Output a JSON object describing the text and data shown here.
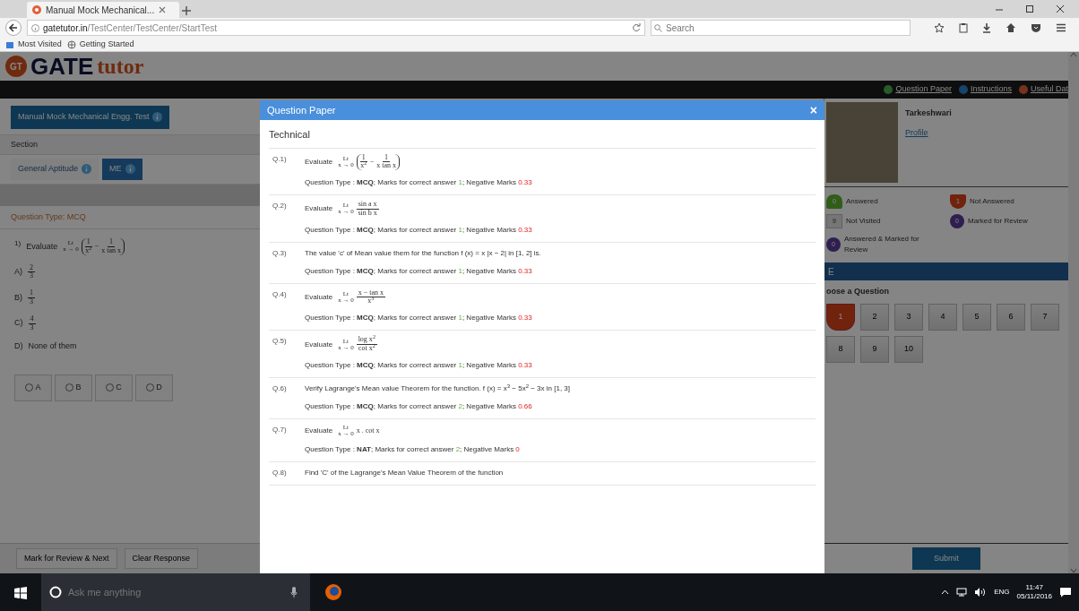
{
  "browser": {
    "tab_title": "Manual Mock Mechanical...",
    "url_host": "gatetutor.in",
    "url_path": "/TestCenter/TestCenter/StartTest",
    "search_placeholder": "Search",
    "bookmarks": [
      "Most Visited",
      "Getting Started"
    ]
  },
  "page": {
    "logo": {
      "mark": "GT",
      "word": "GATE",
      "tail": "tutor"
    },
    "test_name": "Manual Mock Mechanical Engg. Test",
    "section_label": "Section",
    "sections": [
      {
        "label": "General Aptitude",
        "selected": false
      },
      {
        "label": "ME",
        "selected": true
      }
    ],
    "question_type": "Question Type: MCQ",
    "question": {
      "number": "1)",
      "prompt": "Evaluate",
      "formula": [
        {
          "kind": "lim",
          "op": "Lt",
          "sub": "x → 0"
        },
        {
          "kind": "paren",
          "items": [
            {
              "kind": "frac",
              "num": "1",
              "den": "x$^{2}$"
            },
            {
              "kind": "text",
              "text": "−"
            },
            {
              "kind": "frac",
              "num": "1",
              "den": "x tan x"
            }
          ]
        }
      ]
    },
    "options": [
      {
        "label": "A)",
        "formula": [
          {
            "kind": "frac",
            "num": "2",
            "den": "3"
          }
        ]
      },
      {
        "label": "B)",
        "formula": [
          {
            "kind": "frac",
            "num": "1",
            "den": "3"
          }
        ]
      },
      {
        "label": "C)",
        "formula": [
          {
            "kind": "frac",
            "num": "4",
            "den": "3"
          }
        ]
      },
      {
        "label": "D)",
        "text": "None of them"
      }
    ],
    "answer_choices": [
      {
        "letter": "A",
        "selected": false
      },
      {
        "letter": "B",
        "selected": false
      },
      {
        "letter": "C",
        "selected": false
      },
      {
        "letter": "D",
        "selected": false
      }
    ],
    "buttons": [
      "Mark for Review & Next",
      "Clear Response"
    ],
    "top_links": [
      {
        "label": "Question Paper",
        "kind": "paper"
      },
      {
        "label": "Instructions",
        "kind": "info"
      },
      {
        "label": "Useful Dat",
        "kind": "data"
      }
    ],
    "candidate": {
      "name": "Tarkeshwari",
      "link": "Profile"
    },
    "legend": [
      {
        "kind": "answered",
        "count": "0",
        "label": "Answered"
      },
      {
        "kind": "unanswered",
        "count": "1",
        "label": "Not Answered"
      },
      {
        "kind": "unvisited",
        "count": "9",
        "label": "Not Visited"
      },
      {
        "kind": "marked",
        "count": "0",
        "label": "Marked for Review"
      },
      {
        "kind": "answeredmarked",
        "count": "0",
        "label": "Answered & Marked for Review"
      }
    ],
    "palette_title": "E",
    "choose_label": "oose a Question",
    "palette": [
      {
        "label": "1",
        "kind": "unanswered"
      },
      {
        "label": "2",
        "kind": "unvisited"
      },
      {
        "label": "3",
        "kind": "unvisited"
      },
      {
        "label": "4",
        "kind": "unvisited"
      },
      {
        "label": "5",
        "kind": "unvisited"
      },
      {
        "label": "6",
        "kind": "unvisited"
      },
      {
        "label": "7",
        "kind": "unvisited"
      },
      {
        "label": "8",
        "kind": "unvisited"
      },
      {
        "label": "9",
        "kind": "unvisited"
      },
      {
        "label": "10",
        "kind": "unvisited"
      }
    ],
    "submit": "Submit"
  },
  "modal": {
    "title": "Question Paper",
    "close": "×",
    "section": "Technical",
    "questions": [
      {
        "number": "Q.1)",
        "prompt": "Evaluate",
        "formula": [
          {
            "kind": "lim",
            "op": "Lt",
            "sub": "x → 0"
          },
          {
            "kind": "paren",
            "items": [
              {
                "kind": "frac",
                "num": "1",
                "den": "x$^{2}$"
              },
              {
                "kind": "text",
                "text": "−"
              },
              {
                "kind": "frac",
                "num": "1",
                "den": "x tan x"
              }
            ]
          }
        ],
        "type_label": "Question Type :",
        "type": "MCQ",
        "marks_label": "; Marks for correct answer",
        "marks": "1",
        "negative_label": "; Negative Marks",
        "negative": "0.33"
      },
      {
        "number": "Q.2)",
        "prompt": "Evaluate",
        "formula": [
          {
            "kind": "lim",
            "op": "Lt",
            "sub": "x → 0"
          },
          {
            "kind": "frac",
            "num": "sin a x",
            "den": "sin b x"
          }
        ],
        "type_label": "Question Type :",
        "type": "MCQ",
        "marks_label": "; Marks for correct answer",
        "marks": "1",
        "negative_label": "; Negative Marks",
        "negative": "0.33"
      },
      {
        "number": "Q.3)",
        "prompt": "The value 'c' of Mean value them for the function f (x) = x  |x − 2|  in  [1, 2] is.",
        "type_label": "Question Type :",
        "type": "MCQ",
        "marks_label": "; Marks for correct answer",
        "marks": "1",
        "negative_label": "; Negative Marks",
        "negative": "0.33"
      },
      {
        "number": "Q.4)",
        "prompt": "Evaluate",
        "formula": [
          {
            "kind": "lim",
            "op": "Lt",
            "sub": "x → 0"
          },
          {
            "kind": "frac",
            "num": "x − tan x",
            "den": "x$^{3}$"
          }
        ],
        "type_label": "Question Type :",
        "type": "MCQ",
        "marks_label": "; Marks for correct answer",
        "marks": "1",
        "negative_label": "; Negative Marks",
        "negative": "0.33"
      },
      {
        "number": "Q.5)",
        "prompt": "Evaluate",
        "formula": [
          {
            "kind": "lim",
            "op": "Lt",
            "sub": "x → 0"
          },
          {
            "kind": "frac",
            "num": "log x$^{2}$",
            "den": "cot x$^{2}$"
          }
        ],
        "type_label": "Question Type :",
        "type": "MCQ",
        "marks_label": "; Marks for correct answer",
        "marks": "1",
        "negative_label": "; Negative Marks",
        "negative": "0.33"
      },
      {
        "number": "Q.6)",
        "prompt": "Verify Lagrange's Mean value Theorem for the function. f (x) = x$^{3}$ − 5x$^{2}$ − 3x in [1, 3]",
        "type_label": "Question Type :",
        "type": "MCQ",
        "marks_label": "; Marks for correct answer",
        "marks": "2",
        "negative_label": "; Negative Marks",
        "negative": "0.66"
      },
      {
        "number": "Q.7)",
        "prompt": "Evaluate",
        "formula": [
          {
            "kind": "lim",
            "op": "Lt",
            "sub": "x → 0"
          },
          {
            "kind": "text",
            "text": "x . cot x"
          }
        ],
        "type_label": "Question Type :",
        "type": "NAT",
        "marks_label": "; Marks for correct answer",
        "marks": "2",
        "negative_label": "; Negative Marks",
        "negative": "0"
      },
      {
        "number": "Q.8)",
        "prompt": "Find 'C' of the Lagrange's Mean Value Theorem of the function"
      }
    ]
  },
  "taskbar": {
    "search_placeholder": "Ask me anything",
    "language": "ENG",
    "time": "11:47",
    "date": "05/11/2016"
  }
}
